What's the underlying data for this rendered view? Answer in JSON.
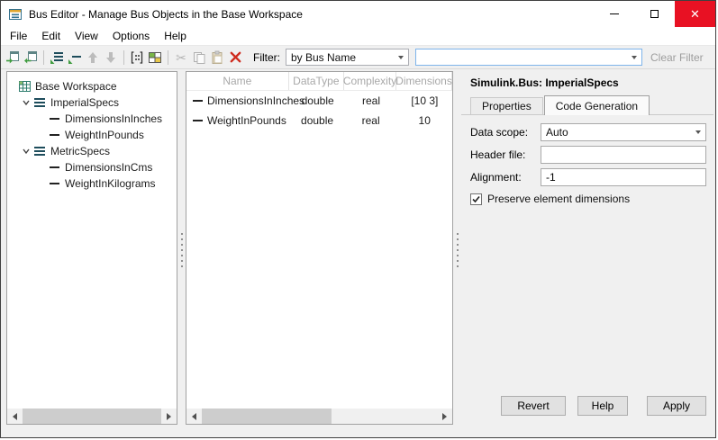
{
  "window": {
    "title": "Bus Editor - Manage Bus Objects in the Base Workspace"
  },
  "menubar": {
    "items": [
      "File",
      "Edit",
      "View",
      "Options",
      "Help"
    ]
  },
  "toolbar": {
    "icons": [
      {
        "name": "import-icon",
        "enabled": true
      },
      {
        "name": "export-icon",
        "enabled": true
      },
      {
        "name": "add-bus-icon",
        "enabled": true
      },
      {
        "name": "add-element-icon",
        "enabled": true
      },
      {
        "name": "move-up-icon",
        "enabled": false
      },
      {
        "name": "move-down-icon",
        "enabled": false
      },
      {
        "name": "matrix-view-icon",
        "enabled": true
      },
      {
        "name": "grid-view-icon",
        "enabled": true
      },
      {
        "name": "cut-icon",
        "enabled": false
      },
      {
        "name": "copy-icon",
        "enabled": false
      },
      {
        "name": "paste-icon",
        "enabled": false
      },
      {
        "name": "delete-icon",
        "enabled": true
      }
    ],
    "filter_label": "Filter:",
    "filter_selected": "by Bus Name",
    "filter_input_value": "",
    "clear_filter_label": "Clear Filter"
  },
  "tree": {
    "rows": [
      {
        "label": "Base Workspace",
        "level": 0,
        "icon": "workspace-icon"
      },
      {
        "label": "ImperialSpecs",
        "level": 1,
        "icon": "bus-icon",
        "expanded": true
      },
      {
        "label": "DimensionsInInches",
        "level": 2,
        "icon": "element-icon"
      },
      {
        "label": "WeightInPounds",
        "level": 2,
        "icon": "element-icon"
      },
      {
        "label": "MetricSpecs",
        "level": 1,
        "icon": "bus-icon",
        "expanded": true
      },
      {
        "label": "DimensionsInCms",
        "level": 2,
        "icon": "element-icon"
      },
      {
        "label": "WeightInKilograms",
        "level": 2,
        "icon": "element-icon"
      }
    ]
  },
  "table": {
    "columns": [
      "Name",
      "DataType",
      "Complexity",
      "Dimensions"
    ],
    "rows": [
      {
        "name": "DimensionsInInches",
        "dataType": "double",
        "complexity": "real",
        "dimensions": "[10 3]"
      },
      {
        "name": "WeightInPounds",
        "dataType": "double",
        "complexity": "real",
        "dimensions": "10"
      }
    ]
  },
  "details": {
    "title": "Simulink.Bus: ImperialSpecs",
    "tabs": [
      "Properties",
      "Code Generation"
    ],
    "active_tab": "Code Generation",
    "fields": {
      "data_scope": {
        "label": "Data scope:",
        "value": "Auto"
      },
      "header_file": {
        "label": "Header file:",
        "value": ""
      },
      "alignment": {
        "label": "Alignment:",
        "value": "-1"
      }
    },
    "preserve_checkbox": {
      "label": "Preserve element dimensions",
      "checked": true
    },
    "buttons": [
      "Revert",
      "Help",
      "Apply"
    ]
  },
  "colors": {
    "close_button": "#e81123",
    "delete_icon": "#cf2b1e",
    "accent_green": "#3f9c3f",
    "bus_icon": "#1e4d5c"
  }
}
